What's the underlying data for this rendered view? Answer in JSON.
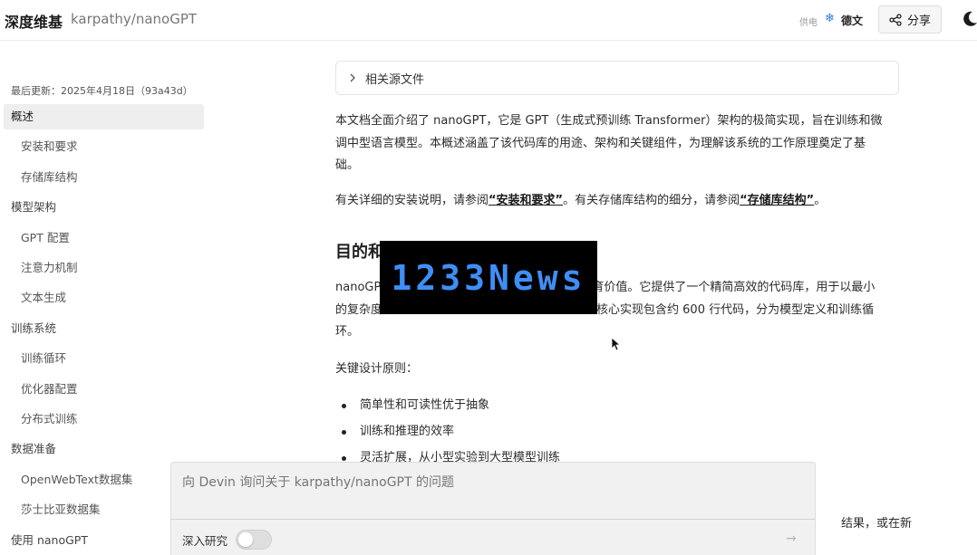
{
  "header": {
    "brand": "深度维基",
    "repo": "karpathy/nanoGPT",
    "powered_by": "供电",
    "powered_brand": "德文",
    "share_label": "分享"
  },
  "sidebar": {
    "last_updated": "最后更新：2025年4月18日（93a43d）",
    "items": [
      {
        "label": "概述",
        "level": 1,
        "active": true
      },
      {
        "label": "安装和要求",
        "level": 2
      },
      {
        "label": "存储库结构",
        "level": 2
      },
      {
        "label": "模型架构",
        "level": 1
      },
      {
        "label": "GPT 配置",
        "level": 2
      },
      {
        "label": "注意力机制",
        "level": 2
      },
      {
        "label": "文本生成",
        "level": 2
      },
      {
        "label": "训练系统",
        "level": 1
      },
      {
        "label": "训练循环",
        "level": 2
      },
      {
        "label": "优化器配置",
        "level": 2
      },
      {
        "label": "分布式训练",
        "level": 2
      },
      {
        "label": "数据准备",
        "level": 1
      },
      {
        "label": "OpenWebText数据集",
        "level": 2
      },
      {
        "label": "莎士比亚数据集",
        "level": 2
      },
      {
        "label": "使用 nanoGPT",
        "level": 1
      }
    ]
  },
  "main": {
    "accordion_label": "相关源文件",
    "intro_line1": "本文档全面介绍了 nanoGPT，它是 GPT（生成式预训练 Transformer）架构的极简实现，旨在训练和微",
    "intro_line2": "调中型语言模型。本概述涵盖了该代码库的用途、架构和关键组件，为理解该系统的工作原理奠定了基",
    "intro_line3": "础。",
    "ref_prefix": "有关详细的安装说明，请参阅",
    "ref_link1": "“安装和要求”",
    "ref_middle": "。有关存储库结构的细分，请参阅",
    "ref_link2": "“存储库结构”",
    "ref_suffix": "。",
    "heading": "目的和",
    "purpose_line1_start": "nanoGP",
    "purpose_line1_end": "育价值。它提供了一个精简高效的代码库，用于以最小",
    "purpose_line2_start": "的复杂度训",
    "purpose_line2_end": "核心实现包含约 600 行代码，分为模型定义和训练循",
    "purpose_line3": "环。",
    "principles_label": "关键设计原则：",
    "bullets": [
      "简单性和可读性优于抽象",
      "训练和推理的效率",
      "灵活扩展，从小型实验到大型模型训练"
    ],
    "behind_text": "结果，或在新"
  },
  "watermark": {
    "text": "1233News"
  },
  "ask": {
    "placeholder": "向 Devin 询问关于 karpathy/nanoGPT 的问题",
    "deep_research_label": "深入研究",
    "deep_research_enabled": false
  },
  "colors": {
    "accent": "#2b7de9",
    "watermark_text": "#3f8ef7",
    "active_nav": "#eeeeee"
  }
}
